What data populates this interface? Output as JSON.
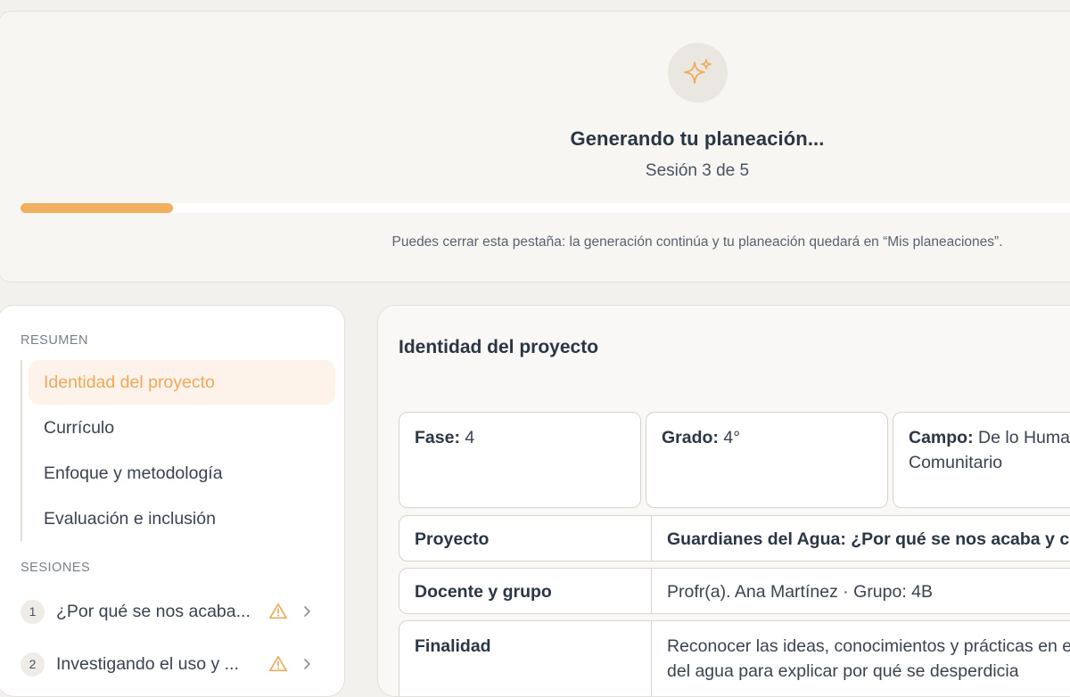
{
  "generation": {
    "title": "Generando tu planeación...",
    "subtitle": "Sesión 3 de 5",
    "progress_fraction": 0.14,
    "note": "Puedes cerrar esta pestaña: la generación continúa y tu planeación quedará en “Mis planeaciones”."
  },
  "sidebar": {
    "summary_heading": "RESUMEN",
    "summary_items": [
      {
        "label": "Identidad del proyecto",
        "active": true
      },
      {
        "label": "Currículo",
        "active": false
      },
      {
        "label": "Enfoque y metodología",
        "active": false
      },
      {
        "label": "Evaluación e inclusión",
        "active": false
      }
    ],
    "sessions_heading": "SESIONES",
    "sessions": [
      {
        "number": "1",
        "label": "¿Por qué se nos acaba...",
        "warning": true
      },
      {
        "number": "2",
        "label": "Investigando el uso y ...",
        "warning": true
      }
    ]
  },
  "main": {
    "section_title": "Identidad del proyecto",
    "fase": {
      "label": "Fase:",
      "value": "4"
    },
    "grado": {
      "label": "Grado:",
      "value": "4°"
    },
    "campo": {
      "label": "Campo:",
      "value": "De lo Humano y lo Comunitario"
    },
    "rows": [
      {
        "label": "Proyecto",
        "value": "Guardianes del Agua: ¿Por qué se nos acaba y cómo cuidarla?"
      },
      {
        "label": "Docente y grupo",
        "value": "Profr(a). Ana Martínez · Grupo: 4B"
      },
      {
        "label": "Finalidad",
        "value": "Reconocer las ideas, conocimientos y prácticas en el uso del agua para explicar por qué se desperdicia"
      }
    ]
  },
  "colors": {
    "accent": "#f0b060",
    "accent_text": "#eea85a",
    "active_bg": "#fdf3ea",
    "page_bg": "#f3f1ee"
  },
  "icons": {
    "header": "sparkles-icon",
    "session_warning": "warning-icon",
    "session_open": "chevron-right-icon"
  }
}
